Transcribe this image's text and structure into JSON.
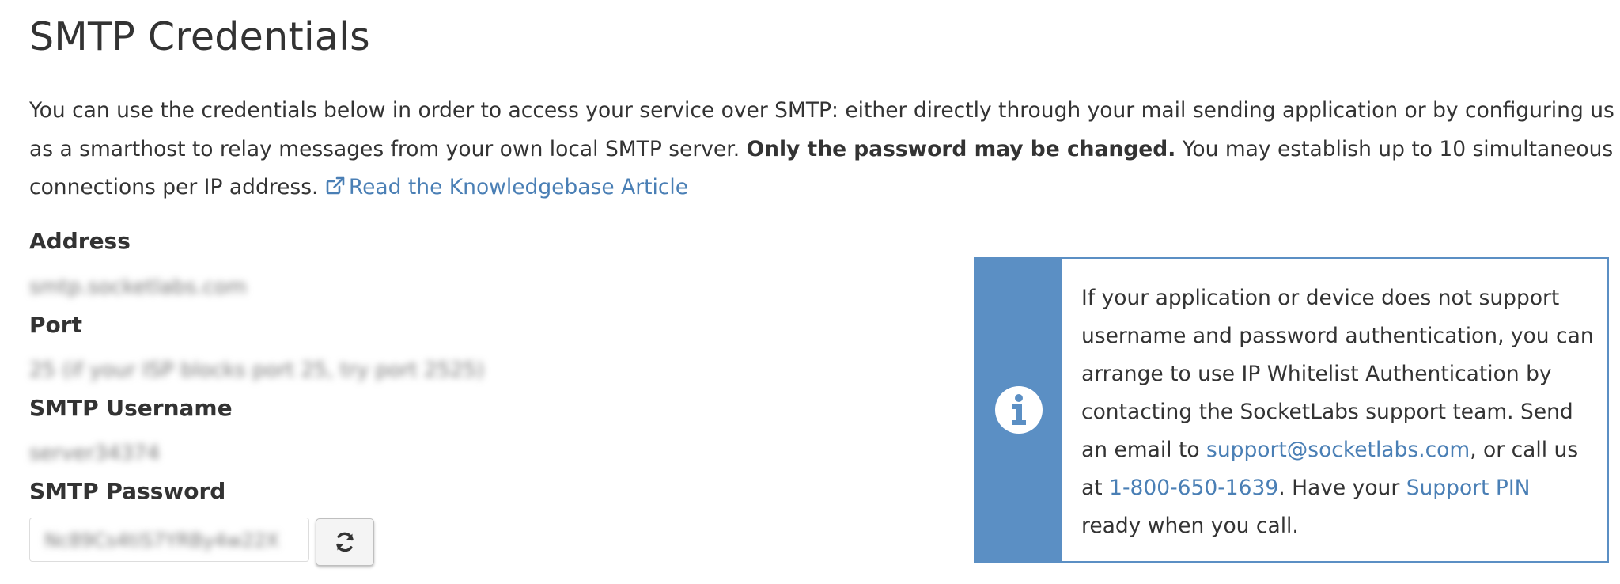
{
  "page": {
    "title": "SMTP Credentials"
  },
  "intro": {
    "text_1": "You can use the credentials below in order to access your service over SMTP: either directly through your mail sending application or by configuring us as a smarthost to relay messages from your own local SMTP server.",
    "bold": "Only the password may be changed.",
    "text_2": "You may establish up to 10 simultaneous connections per IP address.",
    "kb_link_label": "Read the Knowledgebase Article",
    "kb_link_icon": "external-link-icon"
  },
  "credentials": {
    "address_label": "Address",
    "address_value": "smtp.socketlabs.com",
    "port_label": "Port",
    "port_value": "25 (if your ISP blocks port 25, try port 2525)",
    "username_label": "SMTP Username",
    "username_value": "server34374",
    "password_label": "SMTP Password",
    "password_value": "Nc89Cs4tiS7YRBy4w22X",
    "refresh_icon": "refresh-icon"
  },
  "info": {
    "icon": "info-circle-icon",
    "text_1": "If your application or device does not support username and password authentication, you can arrange to use IP Whitelist Authentication by contacting the SocketLabs support team. Send an email to",
    "email": "support@socketlabs.com",
    "text_2": ", or call us at",
    "phone": "1-800-650-1639",
    "text_3": ". Have your",
    "support_pin": "Support PIN",
    "text_4": "ready when you call."
  },
  "colors": {
    "link": "#4a7fb5",
    "info_accent": "#5b8fc4",
    "text": "#333333"
  }
}
